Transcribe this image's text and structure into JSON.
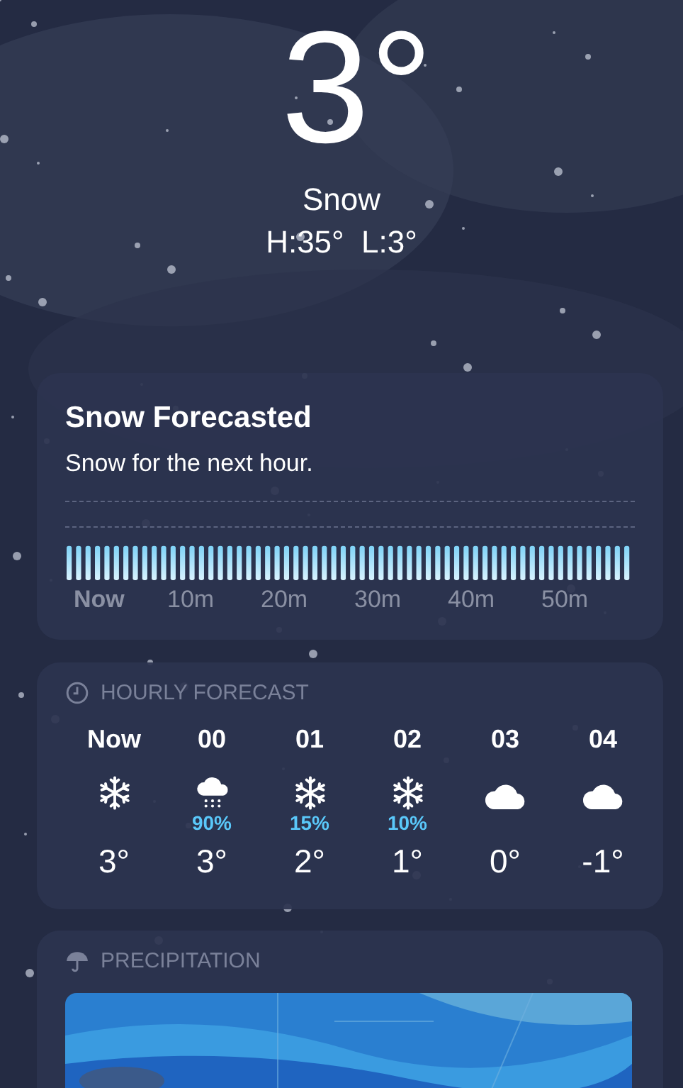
{
  "current": {
    "temperature": "3°",
    "condition": "Snow",
    "high_low": "H:35°  L:3°"
  },
  "next_hour": {
    "title": "Snow Forecasted",
    "summary": "Snow for the next hour.",
    "axis_labels": [
      {
        "label": "Now",
        "selected": true
      },
      {
        "label": "10m",
        "selected": false
      },
      {
        "label": "20m",
        "selected": false
      },
      {
        "label": "30m",
        "selected": false
      },
      {
        "label": "40m",
        "selected": false
      },
      {
        "label": "50m",
        "selected": false
      }
    ]
  },
  "hourly": {
    "header": "HOURLY FORECAST",
    "hours": [
      {
        "time": "Now",
        "kind": "snow",
        "temperature": "3°"
      },
      {
        "time": "00",
        "kind": "cloud-snow",
        "chance": "90%",
        "temperature": "3°"
      },
      {
        "time": "01",
        "kind": "snow",
        "chance": "15%",
        "temperature": "2°"
      },
      {
        "time": "02",
        "kind": "snow",
        "chance": "10%",
        "temperature": "1°"
      },
      {
        "time": "03",
        "kind": "cloud",
        "temperature": "0°"
      },
      {
        "time": "04",
        "kind": "cloud",
        "temperature": "-1°"
      }
    ]
  },
  "precipitation": {
    "header": "PRECIPITATION"
  }
}
